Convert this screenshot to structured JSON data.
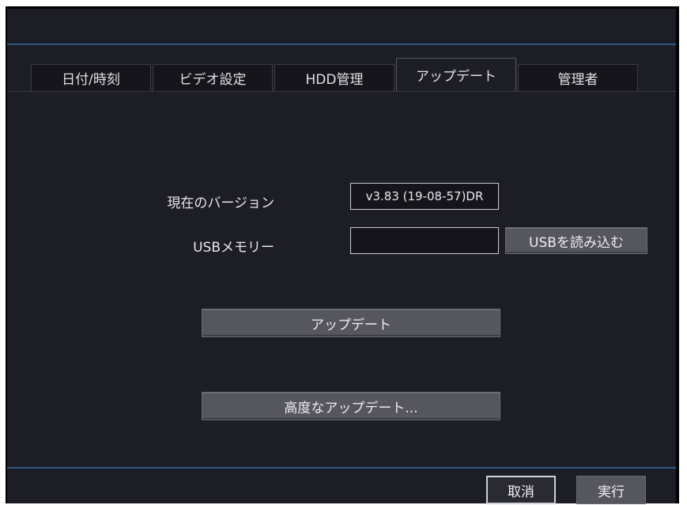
{
  "tabs": [
    {
      "label": "日付/時刻",
      "active": false
    },
    {
      "label": "ビデオ設定",
      "active": false
    },
    {
      "label": "HDD管理",
      "active": false
    },
    {
      "label": "アップデート",
      "active": true
    },
    {
      "label": "管理者",
      "active": false
    }
  ],
  "version": {
    "label": "現在のバージョン",
    "value": "v3.83 (19-08-57)DR"
  },
  "usb": {
    "label": "USBメモリー",
    "value": "",
    "load_button": "USBを読み込む"
  },
  "actions": {
    "update": "アップデート",
    "advanced_update": "高度なアップデート..."
  },
  "footer": {
    "cancel": "取消",
    "execute": "実行"
  },
  "colors": {
    "background": "#1d1d25",
    "accent_line": "#2f5a86",
    "button": "#56565f"
  }
}
